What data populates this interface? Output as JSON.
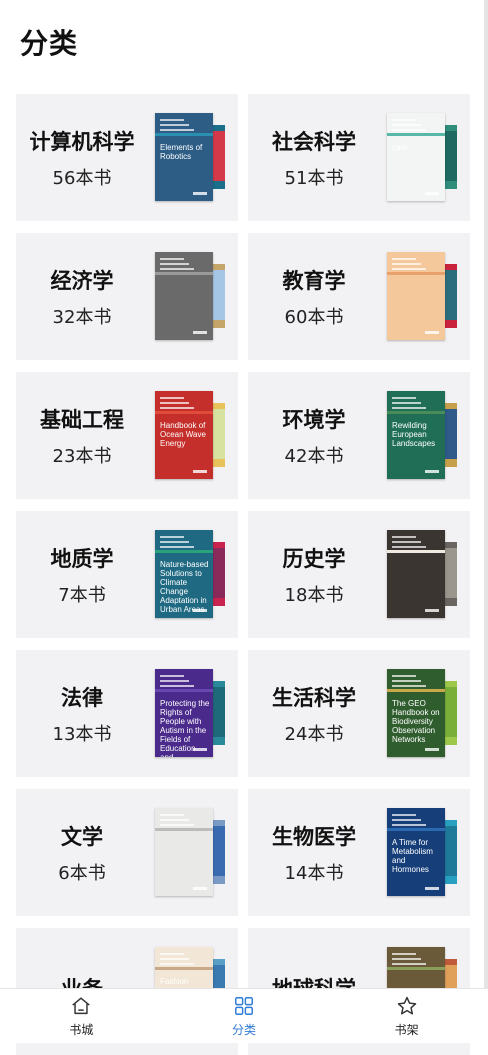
{
  "page": {
    "title": "分类"
  },
  "categories": [
    {
      "name": "计算机科学",
      "count": "56本书",
      "cover": {
        "bg": "#2d5d85",
        "accent": "#2a8fb0",
        "back": "#1b6f8a",
        "back2": "#d4394a",
        "title": "Elements of Robotics"
      }
    },
    {
      "name": "社会科学",
      "count": "51本书",
      "cover": {
        "bg": "#f3f5f4",
        "accent": "#57b8a7",
        "back": "#2f8d7a",
        "back2": "#1e6a63",
        "title": "care"
      }
    },
    {
      "name": "经济学",
      "count": "32本书",
      "cover": {
        "bg": "#6a6a6a",
        "accent": "#9a9a9a",
        "back": "#c6a56a",
        "back2": "#a5c7e5",
        "title": ""
      }
    },
    {
      "name": "教育学",
      "count": "60本书",
      "cover": {
        "bg": "#f4c89a",
        "accent": "#e8a16c",
        "back": "#c9223c",
        "back2": "#2b6d7c",
        "title": ""
      }
    },
    {
      "name": "基础工程",
      "count": "23本书",
      "cover": {
        "bg": "#c42f2b",
        "accent": "#e04b3a",
        "back": "#e8c25a",
        "back2": "#d8e2a0",
        "title": "Handbook of Ocean Wave Energy"
      }
    },
    {
      "name": "环境学",
      "count": "42本书",
      "cover": {
        "bg": "#1f6e55",
        "accent": "#4a8b5a",
        "back": "#c6a04a",
        "back2": "#2f5a8a",
        "title": "Rewilding European Landscapes"
      }
    },
    {
      "name": "地质学",
      "count": "7本书",
      "cover": {
        "bg": "#1f6a82",
        "accent": "#2aa37a",
        "back": "#c9234f",
        "back2": "#8a2a5a",
        "title": "Nature-based Solutions to Climate Change Adaptation in Urban Areas"
      }
    },
    {
      "name": "历史学",
      "count": "18本书",
      "cover": {
        "bg": "#3a3530",
        "accent": "#efe9df",
        "back": "#6a6560",
        "back2": "#9a958d",
        "title": ""
      }
    },
    {
      "name": "法律",
      "count": "13本书",
      "cover": {
        "bg": "#4a2a8a",
        "accent": "#6a46b0",
        "back": "#2a8a9a",
        "back2": "#1f6a7a",
        "title": "Protecting the Rights of People with Autism in the Fields of Education and Employment"
      }
    },
    {
      "name": "生活科学",
      "count": "24本书",
      "cover": {
        "bg": "#2f5d2e",
        "accent": "#c7a84a",
        "back": "#9dc84a",
        "back2": "#7ab03a",
        "title": "The GEO Handbook on Biodiversity Observation Networks"
      }
    },
    {
      "name": "文学",
      "count": "6本书",
      "cover": {
        "bg": "#e9e9e7",
        "accent": "#bcbcbc",
        "back": "#7a9ac6",
        "back2": "#3a6ab0",
        "title": ""
      }
    },
    {
      "name": "生物医学",
      "count": "14本书",
      "cover": {
        "bg": "#163f7a",
        "accent": "#2a6ab0",
        "back": "#2aa0c0",
        "back2": "#1f7a9a",
        "title": "A Time for Metabolism and Hormones"
      }
    },
    {
      "name": "业务",
      "count": "",
      "cover": {
        "bg": "#f2e6d6",
        "accent": "#c9a88a",
        "back": "#5aa0c6",
        "back2": "#3a7ab0",
        "title": "Fashion"
      }
    },
    {
      "name": "地球科学",
      "count": "",
      "cover": {
        "bg": "#6a5a3a",
        "accent": "#8aa05a",
        "back": "#c05a3a",
        "back2": "#e0a05a",
        "title": ""
      }
    }
  ],
  "nav": {
    "items": [
      {
        "label": "书城",
        "icon": "home-icon"
      },
      {
        "label": "分类",
        "icon": "grid-icon"
      },
      {
        "label": "书架",
        "icon": "star-icon"
      }
    ],
    "active": 1,
    "active_color": "#2f7bd6"
  }
}
